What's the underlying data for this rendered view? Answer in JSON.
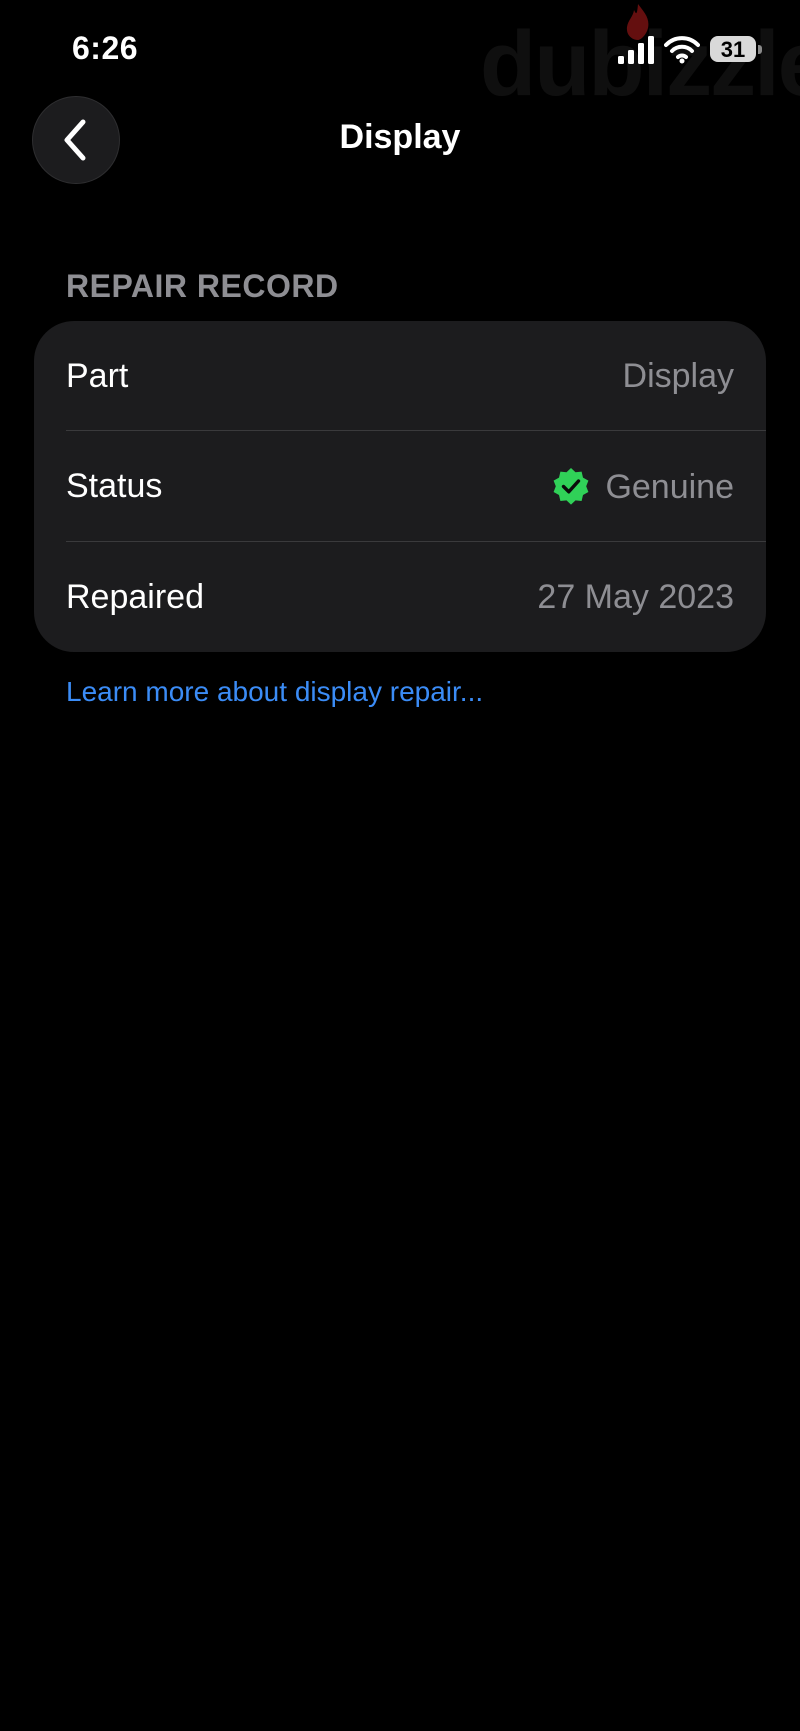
{
  "status_bar": {
    "time": "6:26",
    "battery_level": "31",
    "watermark": "dubizzle",
    "icons": [
      "signal-icon",
      "wifi-icon",
      "battery-icon"
    ]
  },
  "nav": {
    "back_icon": "chevron-left-icon",
    "title": "Display"
  },
  "repair_record": {
    "header": "REPAIR RECORD",
    "rows": [
      {
        "label": "Part",
        "value": "Display"
      },
      {
        "label": "Status",
        "value": "Genuine",
        "icon": "verified-check-icon",
        "icon_color": "#30d158"
      },
      {
        "label": "Repaired",
        "value": "27 May 2023"
      }
    ]
  },
  "learn_more_link": "Learn more about display repair...",
  "colors": {
    "background": "#000000",
    "card": "#1c1c1e",
    "secondary_text": "#8e8e93",
    "link": "#3b8cf6",
    "success": "#30d158"
  }
}
